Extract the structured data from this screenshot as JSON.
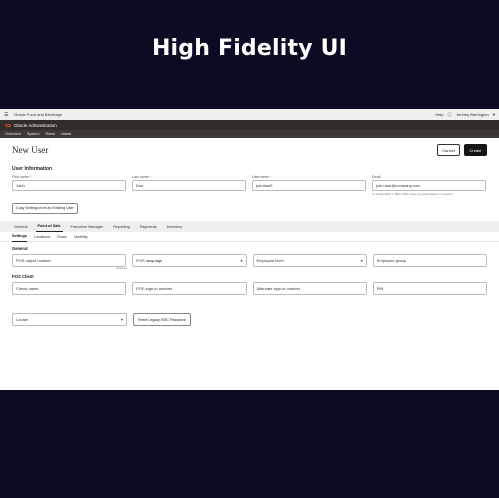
{
  "hero_title": "High Fidelity UI",
  "topbar": {
    "menu_icon": "hamburger-icon",
    "app_name": "Oracle Food and Beverage",
    "help": "Help",
    "user": "Jeremy Barrington",
    "help_icon": "question-circle-icon",
    "chevron_icon": "chevron-down-icon"
  },
  "admin_bar": {
    "title": "Oracle Administration"
  },
  "nav": [
    "Overview",
    "System",
    "Roles",
    "Users"
  ],
  "page": {
    "title": "New User",
    "cancel": "Cancel",
    "create": "Create"
  },
  "user_info": {
    "title": "User Information",
    "fields": [
      {
        "label": "First name *",
        "value": "John"
      },
      {
        "label": "Last name *",
        "value": "Doe"
      },
      {
        "label": "Username *",
        "value": "johndoe5"
      },
      {
        "label": "Email",
        "value": "john.doe@company.com"
      }
    ],
    "email_hint": "To assign EMC or Back Office roles, an email address is required.",
    "copy_button": "Copy Settings from an Existing User"
  },
  "tabs": [
    "General",
    "Point of Sale",
    "Franchise Manager",
    "Reporting",
    "Payments",
    "Inventory"
  ],
  "subtabs": [
    "Settings",
    "Locations",
    "Roles",
    "Visibility"
  ],
  "general": {
    "title": "General",
    "pos_object_number": "POS object number",
    "pos_object_hint": "Required",
    "pos_language": "POS language",
    "employee_level": "Employee level",
    "employee_group": "Employee group"
  },
  "pos_client": {
    "title": "POS Client",
    "check_name": "Check name",
    "pos_signin": "POS sign-in number",
    "alt_signin": "Alternate sign-in number",
    "pin": "PIN"
  },
  "bottom": {
    "locale": "Locale",
    "reset_button": "Reset Legacy EMC Password"
  }
}
